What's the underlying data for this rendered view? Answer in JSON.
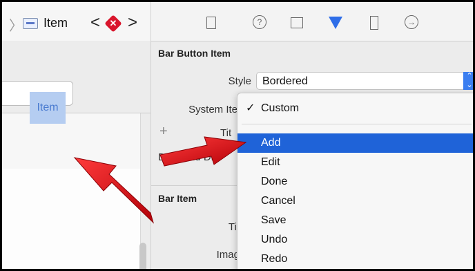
{
  "jumpbar": {
    "item_label": "Item",
    "back": "<",
    "forward": ">",
    "sep": "〉",
    "error_glyph": "✕"
  },
  "canvas": {
    "bar_item_label": "Item"
  },
  "inspector_toolbar": {
    "icons": [
      "file-icon",
      "help-icon",
      "identity-icon",
      "attributes-icon",
      "size-icon",
      "connections-icon"
    ],
    "help_glyph": "?",
    "conn_glyph": "→"
  },
  "bar_button_item": {
    "title": "Bar Button Item",
    "style_label": "Style",
    "style_value": "Bordered",
    "system_item_label": "System Ite",
    "title_label_partial": "Tit",
    "drag_drop_label": "Drag and Dro"
  },
  "bar_item": {
    "title": "Bar Item",
    "title_label": "Tit",
    "image_label": "Imag"
  },
  "menu": {
    "checkmark": "✓",
    "items": [
      {
        "label": "Custom",
        "checked": true
      },
      {
        "label": "Add",
        "selected": true
      },
      {
        "label": "Edit"
      },
      {
        "label": "Done"
      },
      {
        "label": "Cancel"
      },
      {
        "label": "Save"
      },
      {
        "label": "Undo"
      },
      {
        "label": "Redo"
      }
    ]
  },
  "colors": {
    "accent": "#2f6ee8",
    "selection": "#1f63d8",
    "arrow": "#e0141c"
  },
  "stepper_glyph": "⌃"
}
